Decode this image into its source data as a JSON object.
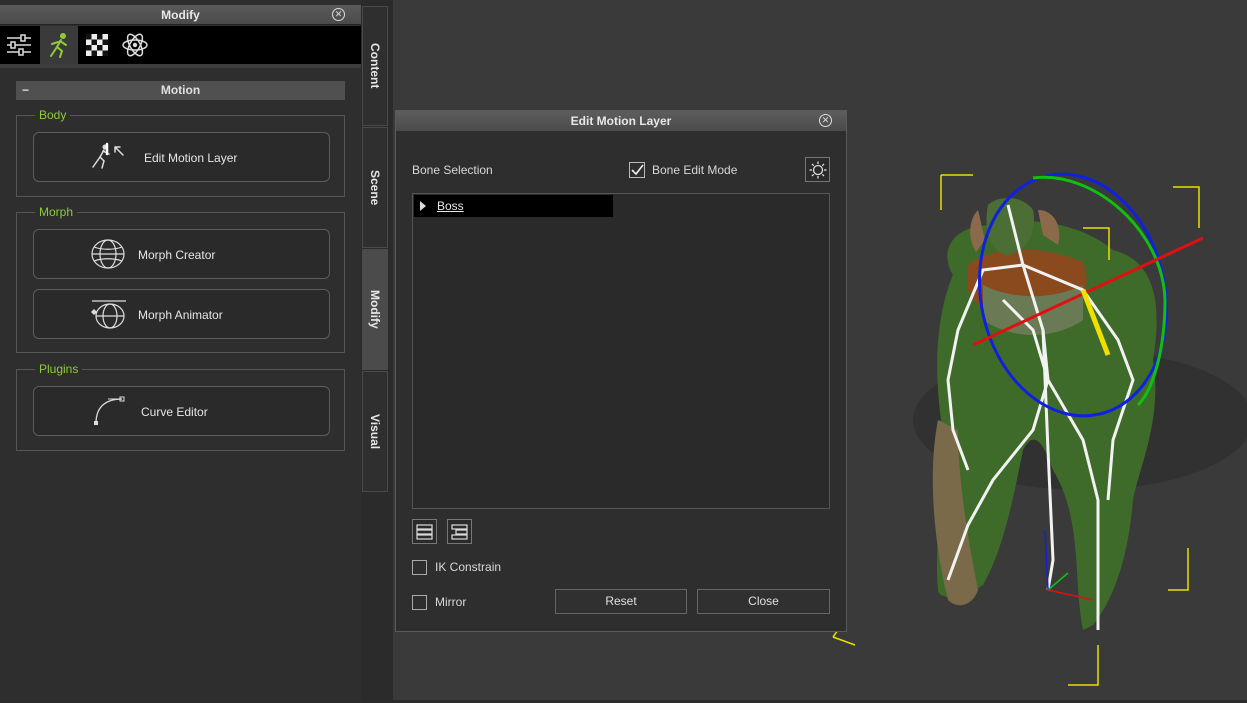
{
  "modify_panel": {
    "title": "Modify",
    "toolbar": {
      "icons": [
        "sliders-icon",
        "motion-runner-icon",
        "checker-material-icon",
        "atom-physics-icon"
      ],
      "active_index": 1
    },
    "section_title": "Motion",
    "groups": [
      {
        "label": "Body",
        "buttons": [
          {
            "label": "Edit Motion Layer",
            "icon": "edit-motion-layer-icon"
          }
        ]
      },
      {
        "label": "Morph",
        "buttons": [
          {
            "label": "Morph Creator",
            "icon": "morph-creator-icon"
          },
          {
            "label": "Morph Animator",
            "icon": "morph-animator-icon"
          }
        ]
      },
      {
        "label": "Plugins",
        "buttons": [
          {
            "label": "Curve Editor",
            "icon": "curve-editor-icon"
          }
        ]
      }
    ]
  },
  "side_tabs": [
    {
      "label": "Content",
      "active": false
    },
    {
      "label": "Scene",
      "active": false
    },
    {
      "label": "Modify",
      "active": true
    },
    {
      "label": "Visual",
      "active": false
    }
  ],
  "dialog": {
    "title": "Edit Motion Layer",
    "bone_selection_label": "Bone Selection",
    "bone_edit_mode_label": "Bone Edit Mode",
    "bone_edit_mode_checked": true,
    "tree_items": [
      {
        "label": "Boss",
        "expanded": false,
        "selected": true
      }
    ],
    "ik_constrain_label": "IK Constrain",
    "ik_constrain_checked": false,
    "mirror_label": "Mirror",
    "mirror_checked": false,
    "reset_label": "Reset",
    "close_label": "Close"
  },
  "colors": {
    "accent_green": "#8ccc3c",
    "gizmo_x": "#e01010",
    "gizmo_y": "#10c010",
    "gizmo_z": "#1020e0",
    "bounding_box": "#e8e000"
  }
}
